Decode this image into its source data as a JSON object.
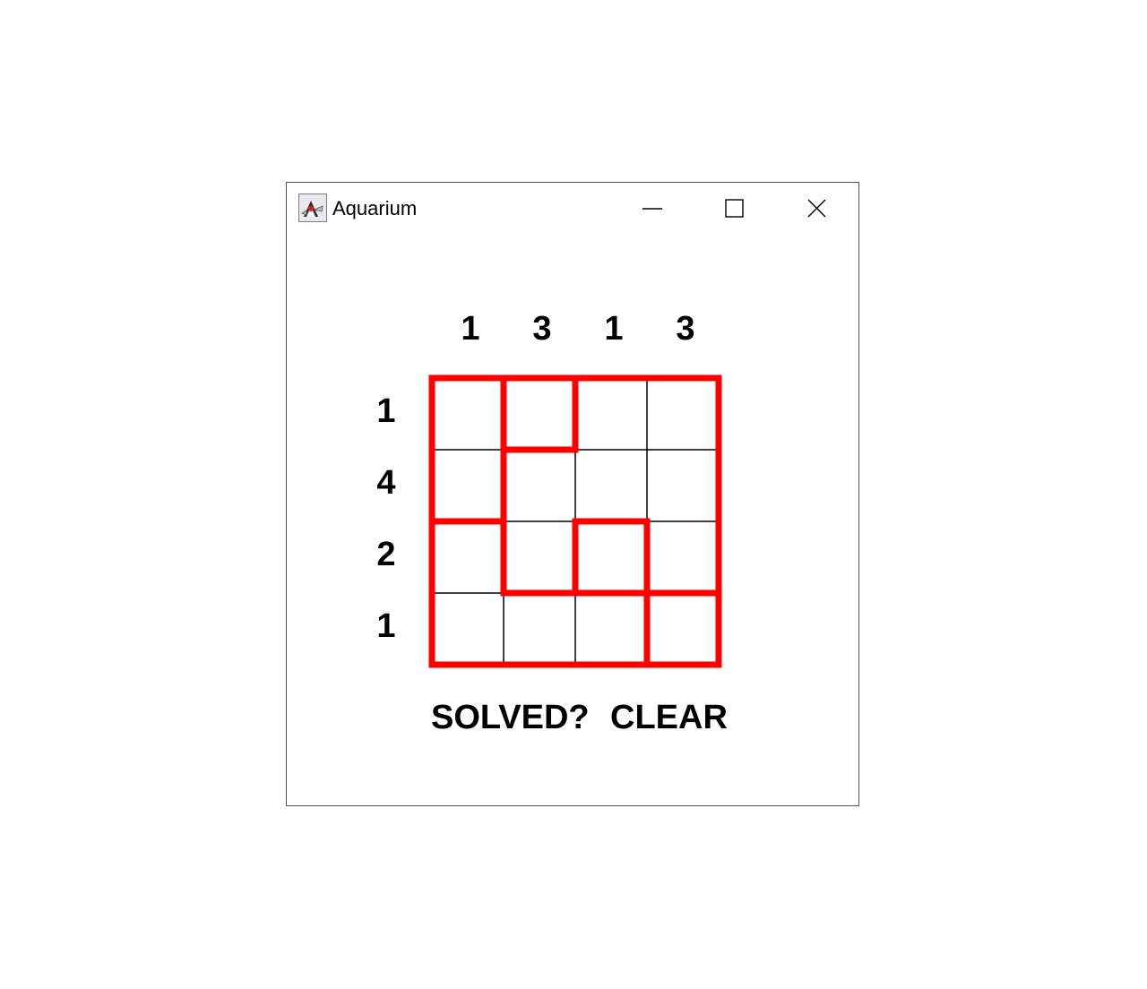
{
  "window": {
    "title": "Aquarium"
  },
  "puzzle": {
    "column_clues": [
      "1",
      "3",
      "1",
      "3"
    ],
    "row_clues": [
      "1",
      "4",
      "2",
      "1"
    ],
    "grid_rows": 4,
    "grid_cols": 4,
    "region_map": [
      [
        0,
        1,
        2,
        2
      ],
      [
        0,
        2,
        2,
        2
      ],
      [
        3,
        2,
        4,
        2
      ],
      [
        3,
        3,
        3,
        5
      ]
    ],
    "filled_cells": [],
    "region_border_color": "#ff0000",
    "grid_line_color": "#000000"
  },
  "actions": {
    "solved_label": "SOLVED?",
    "clear_label": "CLEAR"
  }
}
